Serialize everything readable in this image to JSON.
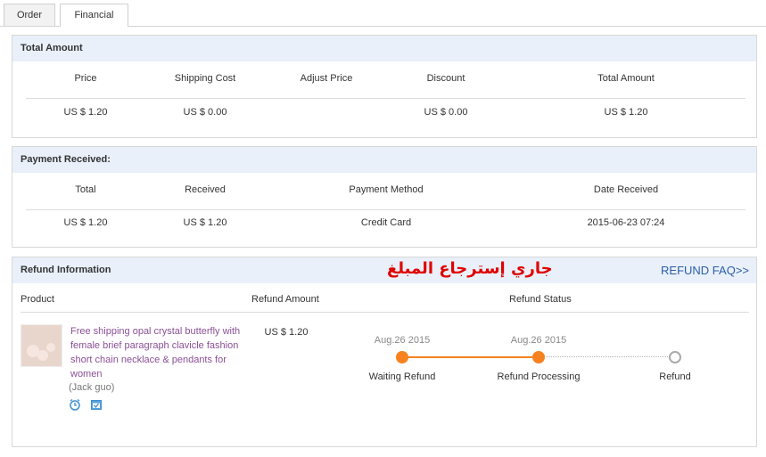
{
  "tabs": [
    {
      "label": "Order"
    },
    {
      "label": "Financial"
    }
  ],
  "total_amount": {
    "title": "Total Amount",
    "headers": [
      "Price",
      "Shipping Cost",
      "Adjust Price",
      "Discount",
      "Total Amount"
    ],
    "values": [
      "US $ 1.20",
      "US $ 0.00",
      "",
      "US $ 0.00",
      "US $ 1.20"
    ]
  },
  "payment": {
    "title": "Payment Received:",
    "headers": [
      "Total",
      "Received",
      "Payment Method",
      "Date Received"
    ],
    "values": [
      "US $ 1.20",
      "US $ 1.20",
      "Credit Card",
      "2015-06-23 07:24"
    ]
  },
  "refund": {
    "title": "Refund Information",
    "annotation": "جاري إسترجاع المبلغ",
    "faq_link": "REFUND FAQ>>",
    "headers": [
      "Product",
      "Refund Amount",
      "Refund Status"
    ],
    "product_title": "Free shipping opal crystal butterfly with female brief paragraph clavicle fashion short chain necklace & pendants for women",
    "seller": "(Jack guo)",
    "amount": "US $ 1.20",
    "steps": [
      {
        "date": "Aug.26 2015",
        "label": "Waiting Refund",
        "state": "done"
      },
      {
        "date": "Aug.26 2015",
        "label": "Refund Processing",
        "state": "done"
      },
      {
        "date": "",
        "label": "Refund",
        "state": "pending"
      }
    ]
  },
  "colors": {
    "accent": "#f5821f",
    "header_bg": "#e9f0fa",
    "link": "#2c5ea8",
    "product_link": "#8a4f96",
    "annotation": "#e00000"
  },
  "icons": [
    "alarm-clock-icon",
    "calendar-icon"
  ]
}
